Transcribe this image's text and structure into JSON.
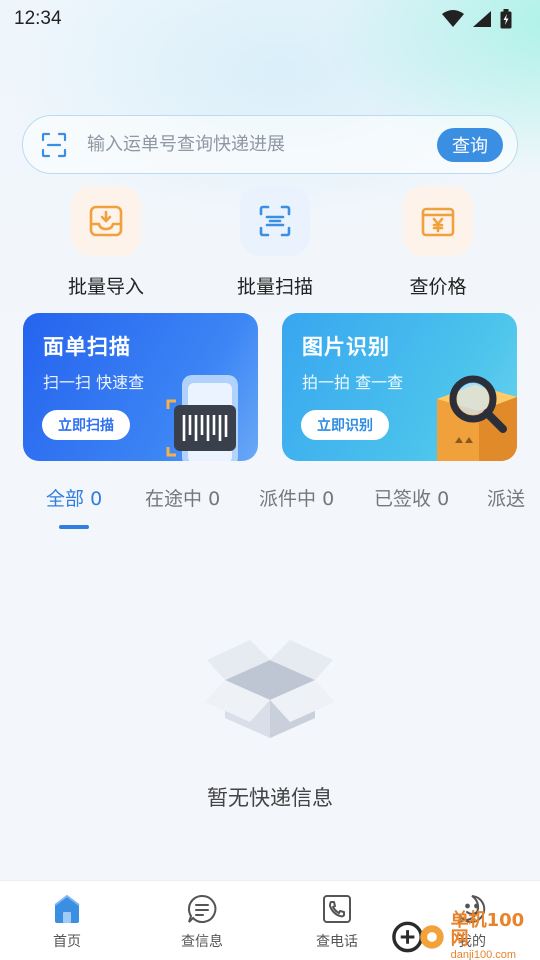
{
  "status_bar": {
    "time": "12:34"
  },
  "search": {
    "placeholder": "输入运单号查询快递进展",
    "button_label": "查询"
  },
  "quick_actions": [
    {
      "label": "批量导入",
      "icon": "inbox-import-icon"
    },
    {
      "label": "批量扫描",
      "icon": "scan-icon"
    },
    {
      "label": "查价格",
      "icon": "price-yen-icon"
    }
  ],
  "cards": [
    {
      "title": "面单扫描",
      "subtitle": "扫一扫 快速查",
      "button": "立即扫描",
      "icon": "barcode-phone-icon"
    },
    {
      "title": "图片识别",
      "subtitle": "拍一拍 查一查",
      "button": "立即识别",
      "icon": "package-magnifier-icon"
    }
  ],
  "tabs": [
    {
      "label": "全部",
      "count": "0",
      "active": true
    },
    {
      "label": "在途中",
      "count": "0"
    },
    {
      "label": "派件中",
      "count": "0"
    },
    {
      "label": "已签收",
      "count": "0"
    },
    {
      "label": "派送",
      "count": ""
    }
  ],
  "empty_state": {
    "text": "暂无快递信息",
    "icon": "empty-box-icon"
  },
  "bottom_nav": [
    {
      "label": "首页",
      "icon": "home-icon",
      "active": true
    },
    {
      "label": "查信息",
      "icon": "message-icon"
    },
    {
      "label": "查电话",
      "icon": "phone-icon"
    },
    {
      "label": "我的",
      "icon": "profile-icon"
    }
  ],
  "watermark": {
    "title": "单机100网",
    "url": "danji100.com"
  },
  "colors": {
    "accent": "#2f7ee0",
    "search_button": "#3b8fe3",
    "orange": "#f0a13c",
    "card_blue": "#2f6ff0",
    "card_cyan": "#3fbfe8"
  }
}
